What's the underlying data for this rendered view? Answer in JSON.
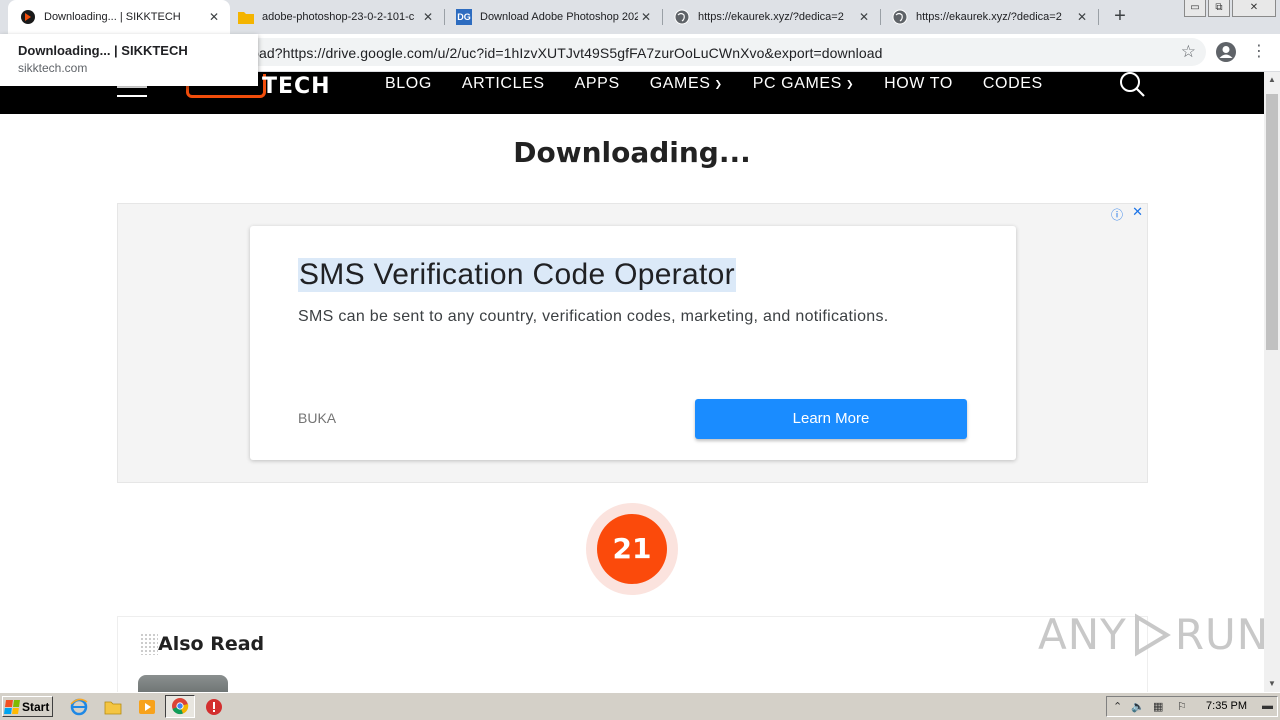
{
  "browser": {
    "tabs": [
      {
        "title": "Downloading... | SIKKTECH",
        "active": true,
        "icon": "sikktech-favicon"
      },
      {
        "title": "adobe-photoshop-23-0-2-101-c",
        "active": false,
        "icon": "folder-icon"
      },
      {
        "title": "Download Adobe Photoshop 202",
        "active": false,
        "icon": "dg-favicon"
      },
      {
        "title": "https://ekaurek.xyz/?dedica=2",
        "active": false,
        "icon": "globe-icon"
      },
      {
        "title": "https://ekaurek.xyz/?dedica=2",
        "active": false,
        "icon": "globe-icon"
      }
    ],
    "new_tab": "+",
    "dg_favicon_text": "DG",
    "url": "nload?https://drive.google.com/u/2/uc?id=1hIzvXUTJvt49S5gfFA7zurOoLuCWnXvo&export=download",
    "tooltip": {
      "title": "Downloading... | SIKKTECH",
      "domain": "sikktech.com"
    },
    "window_controls": {
      "minimize": "▭",
      "restore": "⧉",
      "close": "✕"
    }
  },
  "site": {
    "logo_text": "TECH",
    "nav": [
      {
        "label": "BLOG",
        "dropdown": false
      },
      {
        "label": "ARTICLES",
        "dropdown": false
      },
      {
        "label": "APPS",
        "dropdown": false
      },
      {
        "label": "GAMES",
        "dropdown": true
      },
      {
        "label": "PC GAMES",
        "dropdown": true
      },
      {
        "label": "HOW TO",
        "dropdown": false
      },
      {
        "label": "CODES",
        "dropdown": false
      }
    ],
    "page_title": "Downloading...",
    "countdown": "21",
    "also_read_title": "Also Read"
  },
  "ad": {
    "info_icon": "ⓘ",
    "close_icon": "✕",
    "headline": "SMS Verification Code Operator",
    "body": "SMS can be sent to any country, verification codes, marketing, and notifications.",
    "advertiser": "BUKA",
    "cta": "Learn More"
  },
  "watermark": {
    "left": "ANY",
    "right": "RUN"
  },
  "taskbar": {
    "start_label": "Start",
    "clock": "7:35 PM",
    "colors": {
      "flag": [
        "#f25022",
        "#7fba00",
        "#00a4ef",
        "#ffb900"
      ]
    }
  },
  "colors": {
    "accent": "#fb4a0b",
    "cta": "#1a8cff",
    "header_bg": "#000000"
  }
}
